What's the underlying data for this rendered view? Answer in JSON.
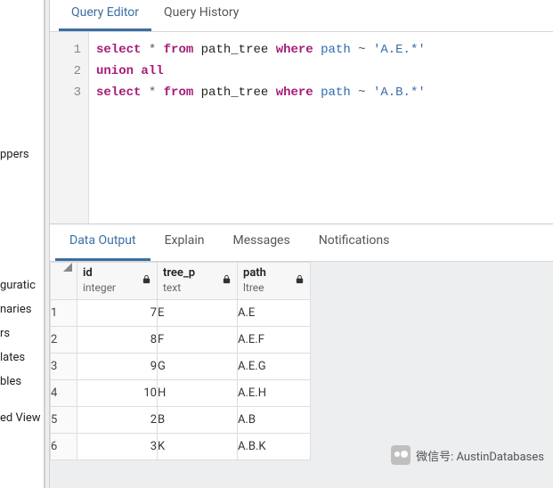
{
  "sidebar": {
    "items": [
      {
        "label": "ppers"
      },
      {
        "label": "guratic"
      },
      {
        "label": "naries"
      },
      {
        "label": "rs"
      },
      {
        "label": "lates"
      },
      {
        "label": "bles"
      },
      {
        "label": "ed View"
      }
    ]
  },
  "editor_tabs": [
    {
      "label": "Query Editor",
      "active": true
    },
    {
      "label": "Query History",
      "active": false
    }
  ],
  "code": {
    "lines": [
      "1",
      "2",
      "3"
    ],
    "tokens": [
      [
        {
          "t": "select",
          "c": "kw"
        },
        {
          "t": " ",
          "c": "op"
        },
        {
          "t": "*",
          "c": "op"
        },
        {
          "t": " ",
          "c": "op"
        },
        {
          "t": "from",
          "c": "kw"
        },
        {
          "t": " ",
          "c": "op"
        },
        {
          "t": "path_tree",
          "c": "ident"
        },
        {
          "t": " ",
          "c": "op"
        },
        {
          "t": "where",
          "c": "kw"
        },
        {
          "t": " ",
          "c": "op"
        },
        {
          "t": "path",
          "c": "col"
        },
        {
          "t": " ~ ",
          "c": "op"
        },
        {
          "t": "'A.E.*'",
          "c": "str"
        }
      ],
      [
        {
          "t": "union",
          "c": "kw"
        },
        {
          "t": " ",
          "c": "op"
        },
        {
          "t": "all",
          "c": "kw"
        }
      ],
      [
        {
          "t": "select",
          "c": "kw"
        },
        {
          "t": " ",
          "c": "op"
        },
        {
          "t": "*",
          "c": "op"
        },
        {
          "t": " ",
          "c": "op"
        },
        {
          "t": "from",
          "c": "kw"
        },
        {
          "t": " ",
          "c": "op"
        },
        {
          "t": "path_tree",
          "c": "ident"
        },
        {
          "t": " ",
          "c": "op"
        },
        {
          "t": "where",
          "c": "kw"
        },
        {
          "t": " ",
          "c": "op"
        },
        {
          "t": "path",
          "c": "col"
        },
        {
          "t": " ~ ",
          "c": "op"
        },
        {
          "t": "'A.B.*'",
          "c": "str"
        }
      ]
    ]
  },
  "result_tabs": [
    {
      "label": "Data Output",
      "active": true
    },
    {
      "label": "Explain",
      "active": false
    },
    {
      "label": "Messages",
      "active": false
    },
    {
      "label": "Notifications",
      "active": false
    }
  ],
  "columns": [
    {
      "name": "id",
      "type": "integer",
      "locked": true
    },
    {
      "name": "tree_p",
      "type": "text",
      "locked": true
    },
    {
      "name": "path",
      "type": "ltree",
      "locked": true
    }
  ],
  "rows": [
    {
      "n": "1",
      "id": "7",
      "tree_p": "E",
      "path": "A.E"
    },
    {
      "n": "2",
      "id": "8",
      "tree_p": "F",
      "path": "A.E.F"
    },
    {
      "n": "3",
      "id": "9",
      "tree_p": "G",
      "path": "A.E.G"
    },
    {
      "n": "4",
      "id": "10",
      "tree_p": "H",
      "path": "A.E.H"
    },
    {
      "n": "5",
      "id": "2",
      "tree_p": "B",
      "path": "A.B"
    },
    {
      "n": "6",
      "id": "3",
      "tree_p": "K",
      "path": "A.B.K"
    }
  ],
  "watermark": {
    "label": "微信号",
    "value": "AustinDatabases"
  }
}
